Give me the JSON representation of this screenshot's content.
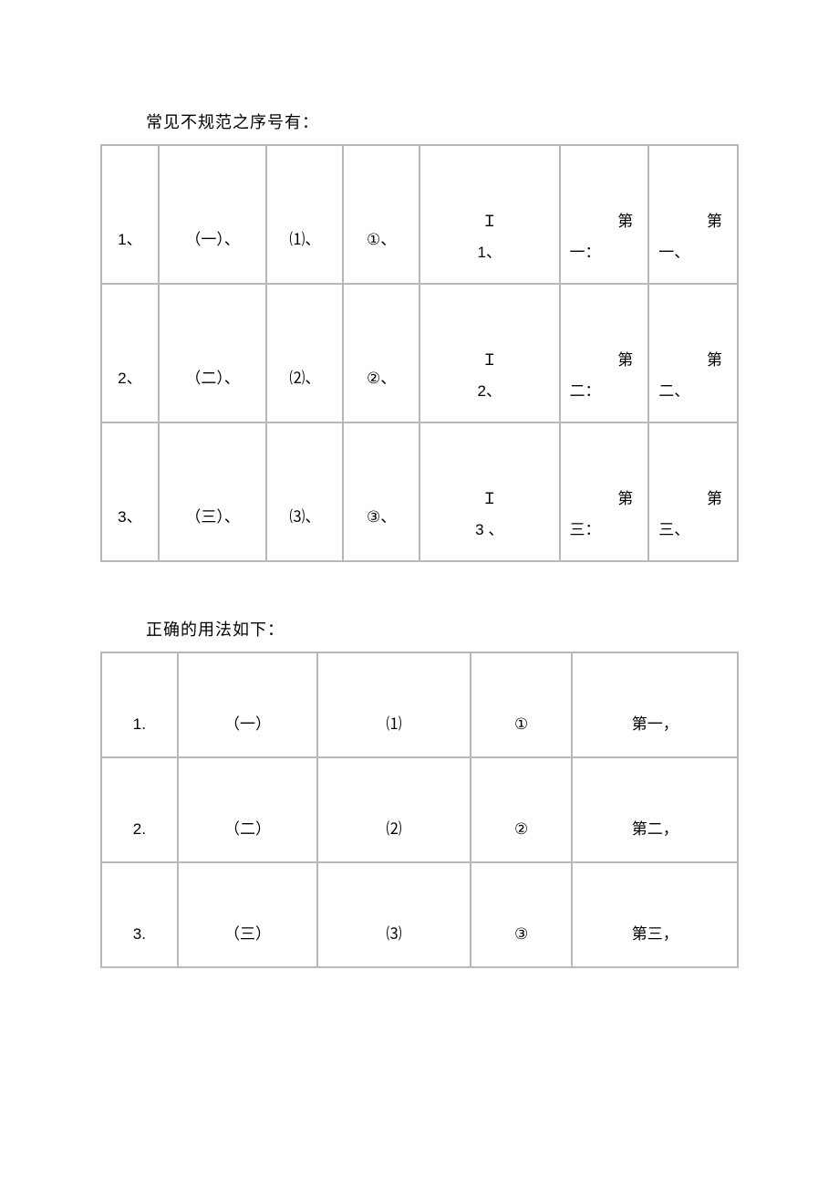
{
  "heading1": "常见不规范之序号有：",
  "heading2": "正确的用法如下：",
  "table1": {
    "rows": [
      {
        "c0": "1、",
        "c1": "（一）、",
        "c2": "⑴、",
        "c3": "①、",
        "c4_l1": "Ｉ",
        "c4_l2": "1、",
        "c5_l1": "第",
        "c5_l2": "一：",
        "c6_l1": "第",
        "c6_l2": "一、"
      },
      {
        "c0": "2、",
        "c1": "（二）、",
        "c2": "⑵、",
        "c3": "②、",
        "c4_l1": "Ｉ",
        "c4_l2": "2、",
        "c5_l1": "第",
        "c5_l2": "二：",
        "c6_l1": "第",
        "c6_l2": "二、"
      },
      {
        "c0": "3、",
        "c1": "（三）、",
        "c2": "⑶、",
        "c3": "③、",
        "c4_l1": "Ｉ",
        "c4_l2": "3 、",
        "c5_l1": "第",
        "c5_l2": "三：",
        "c6_l1": "第",
        "c6_l2": "三、"
      }
    ]
  },
  "table2": {
    "rows": [
      {
        "d0": "1.",
        "d1": "（一）",
        "d2": "⑴",
        "d3": "①",
        "d4": "第一，"
      },
      {
        "d0": "2.",
        "d1": "（二）",
        "d2": "⑵",
        "d3": "②",
        "d4": "第二，"
      },
      {
        "d0": "3.",
        "d1": "（三）",
        "d2": "⑶",
        "d3": "③",
        "d4": "第三，"
      }
    ]
  }
}
